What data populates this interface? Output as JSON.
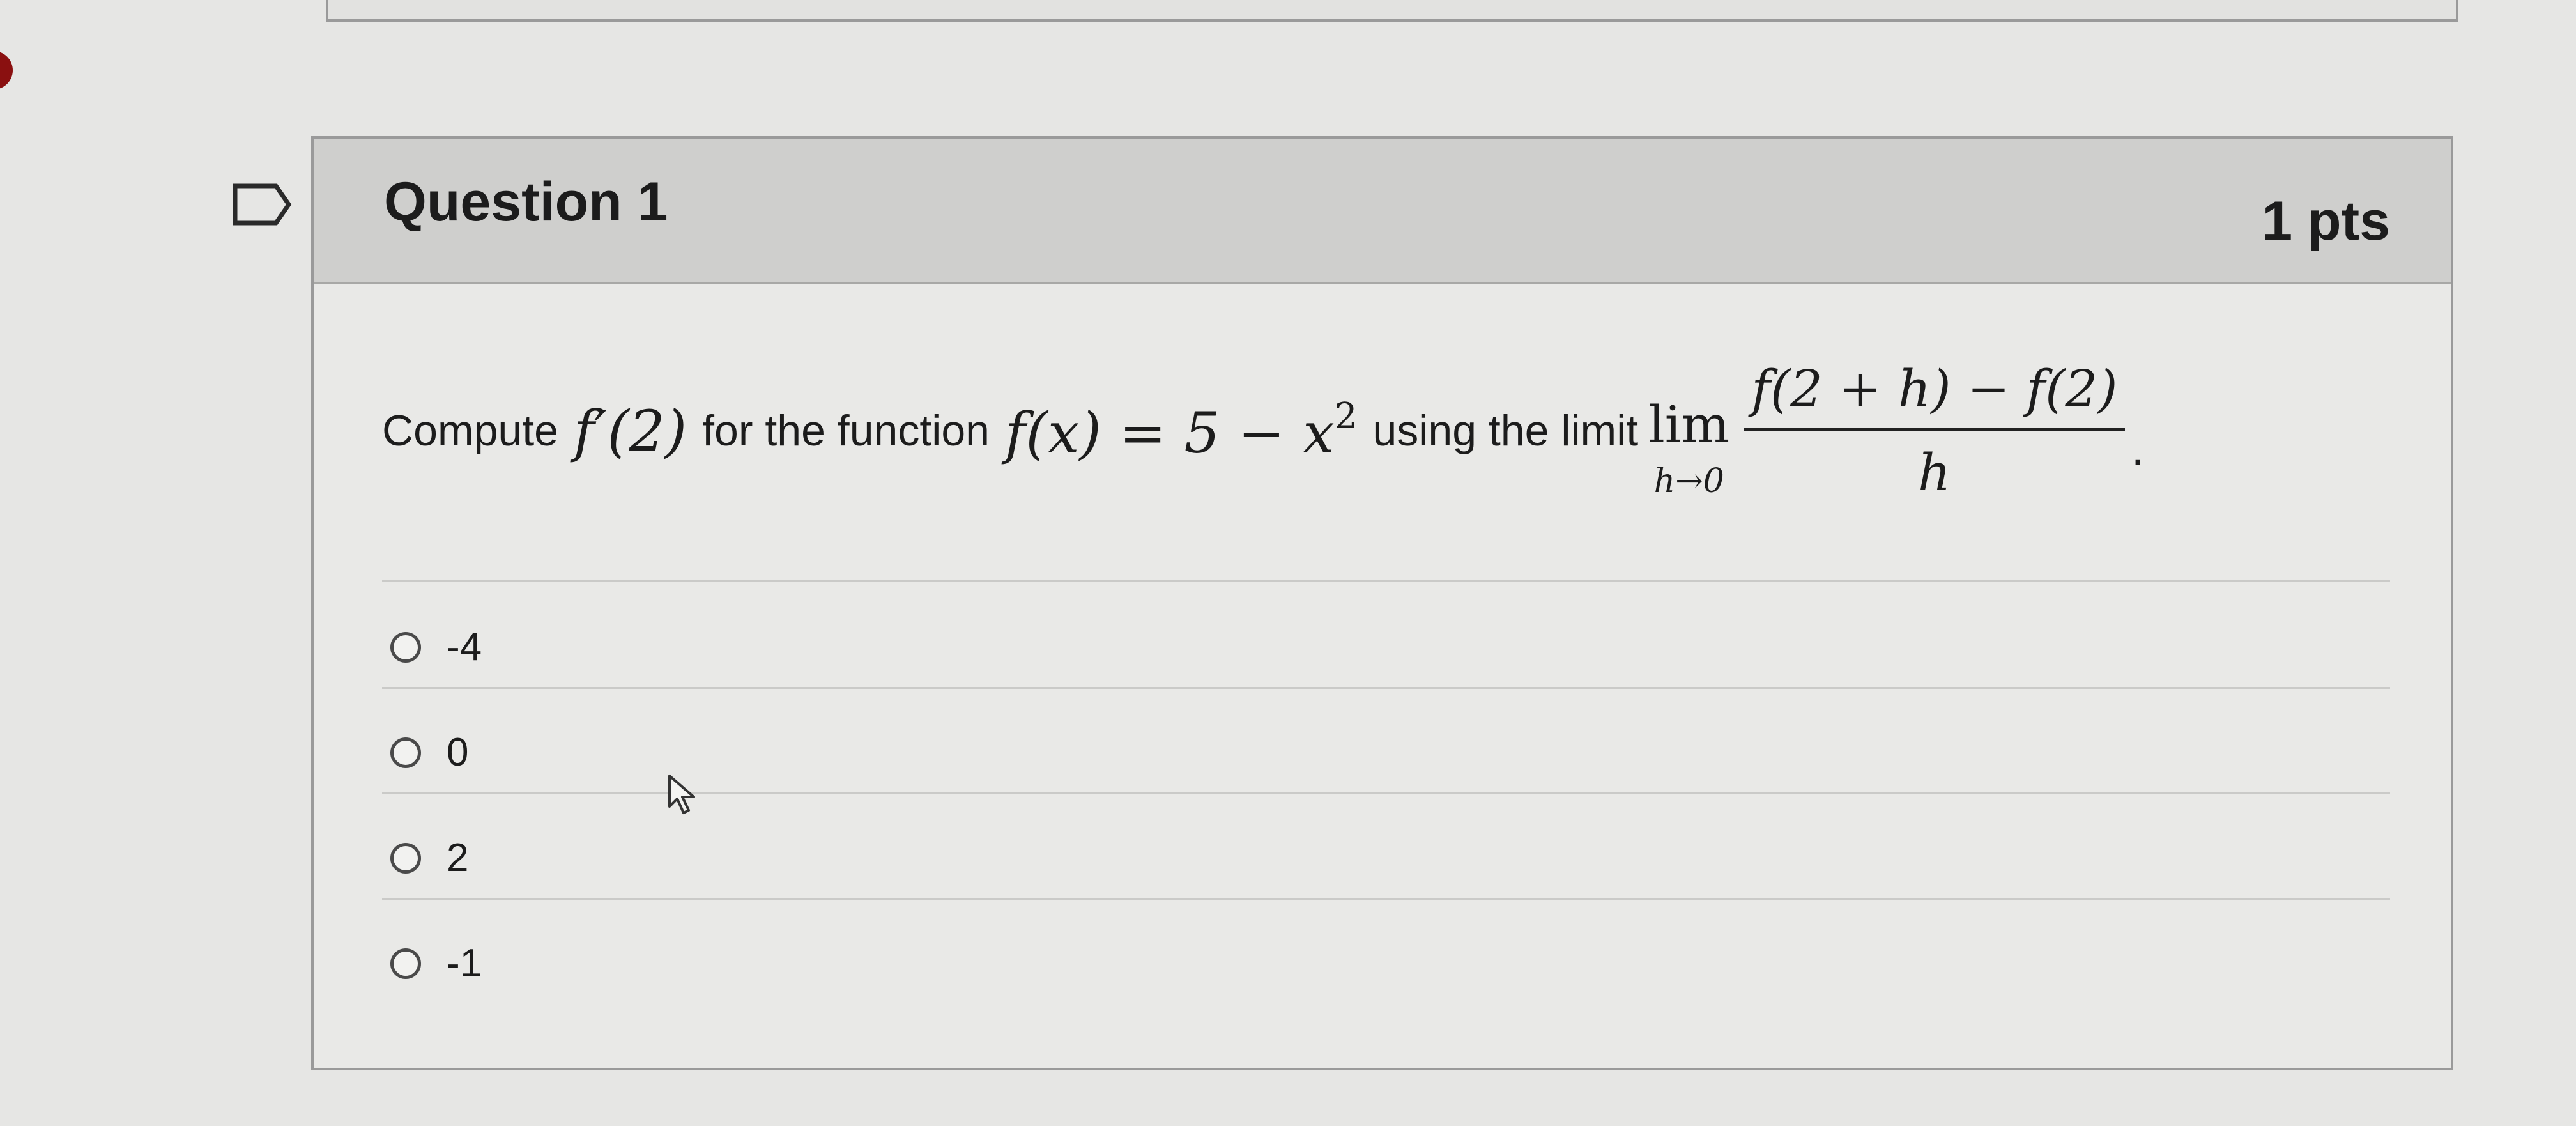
{
  "question": {
    "title": "Question 1",
    "points": "1 pts",
    "text_intro": "Compute",
    "text_mid": "for the function",
    "text_using": "using the limit",
    "period": ".",
    "math_derivative": "f′(2)",
    "math_function": "f(x) = 5 − x",
    "math_exponent": "2",
    "lim_word": "lim",
    "lim_sub": "h→0",
    "frac_numerator": "f(2 + h) − f(2)",
    "frac_denominator": "h"
  },
  "options": [
    {
      "label": "-4"
    },
    {
      "label": "0"
    },
    {
      "label": "2"
    },
    {
      "label": "-1"
    }
  ],
  "icons": {
    "flag": "flag-outline-icon",
    "cursor": "mouse-pointer-icon"
  }
}
